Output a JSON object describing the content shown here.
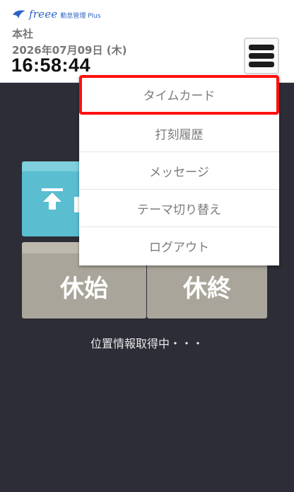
{
  "header": {
    "logo_text": "freee",
    "logo_sub": "勤怠管理 Plus",
    "office": "本社",
    "date": "2026年07月09日 (木)",
    "time": "16:58:44"
  },
  "tiles": {
    "break_start": "休始",
    "break_end": "休終"
  },
  "menu": {
    "items": [
      {
        "label": "タイムカード",
        "selected": true
      },
      {
        "label": "打刻履歴"
      },
      {
        "label": "メッセージ"
      },
      {
        "label": "テーマ切り替え"
      },
      {
        "label": "ログアウト"
      }
    ]
  },
  "status": {
    "text": "位置情報取得中・・・"
  },
  "colors": {
    "background": "#2d2d37",
    "clock_in_tile": "#5bbdd0",
    "break_tile": "#aaa59a",
    "highlight": "#ff1010",
    "brand": "#2c64c4"
  }
}
